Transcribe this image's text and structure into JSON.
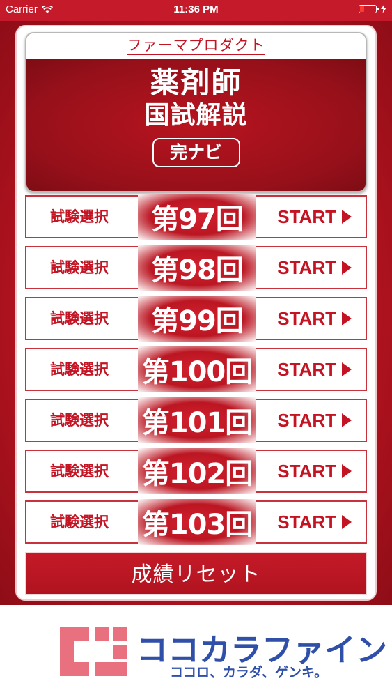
{
  "status": {
    "carrier": "Carrier",
    "time": "11:36 PM"
  },
  "header": {
    "brand": "ファーマプロダクト",
    "title_line1": "薬剤師",
    "title_line2": "国試解説",
    "badge": "完ナビ"
  },
  "exams": [
    {
      "select_label": "試験選択",
      "number": "第97回",
      "start": "START"
    },
    {
      "select_label": "試験選択",
      "number": "第98回",
      "start": "START"
    },
    {
      "select_label": "試験選択",
      "number": "第99回",
      "start": "START"
    },
    {
      "select_label": "試験選択",
      "number": "第100回",
      "start": "START"
    },
    {
      "select_label": "試験選択",
      "number": "第101回",
      "start": "START"
    },
    {
      "select_label": "試験選択",
      "number": "第102回",
      "start": "START"
    },
    {
      "select_label": "試験選択",
      "number": "第103回",
      "start": "START"
    }
  ],
  "reset_label": "成績リセット",
  "footer": {
    "logo_text": "ココカラファイン",
    "logo_sub": "ココロ、カラダ、ゲンキ。"
  },
  "colors": {
    "brand_red": "#c41424",
    "logo_pink": "#e8707f",
    "logo_blue": "#2f4fa8"
  }
}
